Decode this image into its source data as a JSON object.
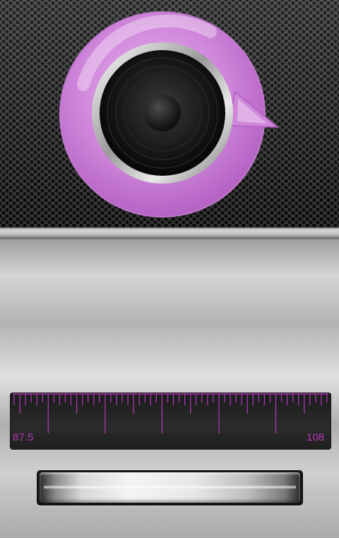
{
  "app": {
    "logo_icon": "speaker-refresh-icon",
    "accent_color": "#c36fcf"
  },
  "tuner": {
    "min_label": "87.5",
    "max_label": "108",
    "scale_color": "#b23ab8",
    "position": 0.0
  }
}
